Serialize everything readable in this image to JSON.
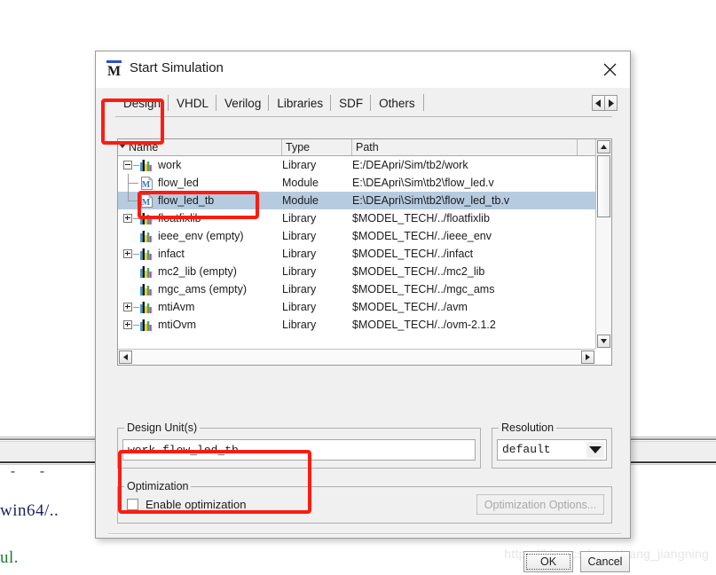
{
  "dialog": {
    "title": "Start Simulation",
    "icon": "modelsim-m-icon",
    "close_label": "✕"
  },
  "tabs": [
    {
      "label": "Design",
      "active": true
    },
    {
      "label": "VHDL",
      "active": false
    },
    {
      "label": "Verilog",
      "active": false
    },
    {
      "label": "Libraries",
      "active": false
    },
    {
      "label": "SDF",
      "active": false
    },
    {
      "label": "Others",
      "active": false
    }
  ],
  "tab_nav": {
    "prev": "◀",
    "next": "▶"
  },
  "list": {
    "columns": [
      "Name",
      "Type",
      "Path"
    ],
    "rows": [
      {
        "name": "work",
        "type": "Library",
        "path": "E:/DEApri/Sim/tb2/work",
        "indent": 0,
        "icon": "library-icon",
        "expander": "minus",
        "selected": false
      },
      {
        "name": "flow_led",
        "type": "Module",
        "path": "E:\\DEApri\\Sim\\tb2\\flow_led.v",
        "indent": 1,
        "icon": "module-icon",
        "expander": "none",
        "selected": false
      },
      {
        "name": "flow_led_tb",
        "type": "Module",
        "path": "E:\\DEApri\\Sim\\tb2\\flow_led_tb.v",
        "indent": 1,
        "icon": "module-icon",
        "expander": "none",
        "selected": true
      },
      {
        "name": "floatfixlib",
        "type": "Library",
        "path": "$MODEL_TECH/../floatfixlib",
        "indent": 0,
        "icon": "library-icon",
        "expander": "plus",
        "selected": false
      },
      {
        "name": "ieee_env  (empty)",
        "type": "Library",
        "path": "$MODEL_TECH/../ieee_env",
        "indent": 0,
        "icon": "library-icon",
        "expander": "none",
        "selected": false
      },
      {
        "name": "infact",
        "type": "Library",
        "path": "$MODEL_TECH/../infact",
        "indent": 0,
        "icon": "library-icon",
        "expander": "plus",
        "selected": false
      },
      {
        "name": "mc2_lib  (empty)",
        "type": "Library",
        "path": "$MODEL_TECH/../mc2_lib",
        "indent": 0,
        "icon": "library-icon",
        "expander": "none",
        "selected": false
      },
      {
        "name": "mgc_ams  (empty)",
        "type": "Library",
        "path": "$MODEL_TECH/../mgc_ams",
        "indent": 0,
        "icon": "library-icon",
        "expander": "none",
        "selected": false
      },
      {
        "name": "mtiAvm",
        "type": "Library",
        "path": "$MODEL_TECH/../avm",
        "indent": 0,
        "icon": "library-icon",
        "expander": "plus",
        "selected": false
      },
      {
        "name": "mtiOvm",
        "type": "Library",
        "path": "$MODEL_TECH/../ovm-2.1.2",
        "indent": 0,
        "icon": "library-icon",
        "expander": "plus",
        "selected": false
      }
    ]
  },
  "design_unit": {
    "group_label": "Design Unit(s)",
    "value": "work.flow_led_tb",
    "placeholder": ""
  },
  "resolution": {
    "group_label": "Resolution",
    "value": "default"
  },
  "optimization": {
    "group_label": "Optimization",
    "checkbox_label": "Enable optimization",
    "checked": false,
    "options_button": "Optimization Options...",
    "options_enabled": false
  },
  "buttons": {
    "ok": "OK",
    "cancel": "Cancel"
  },
  "background": {
    "dashes": "-  -",
    "terminal_line": "win64/..",
    "terminal_green": "ul."
  },
  "watermark": "https://blog.csdn.net/yang_jiangning",
  "colors": {
    "selection": "#b6cbe0",
    "annotation_red": "#fc1c11",
    "dialog_bg": "#f0f0f0",
    "accent_blue": "#2b4fd0"
  }
}
